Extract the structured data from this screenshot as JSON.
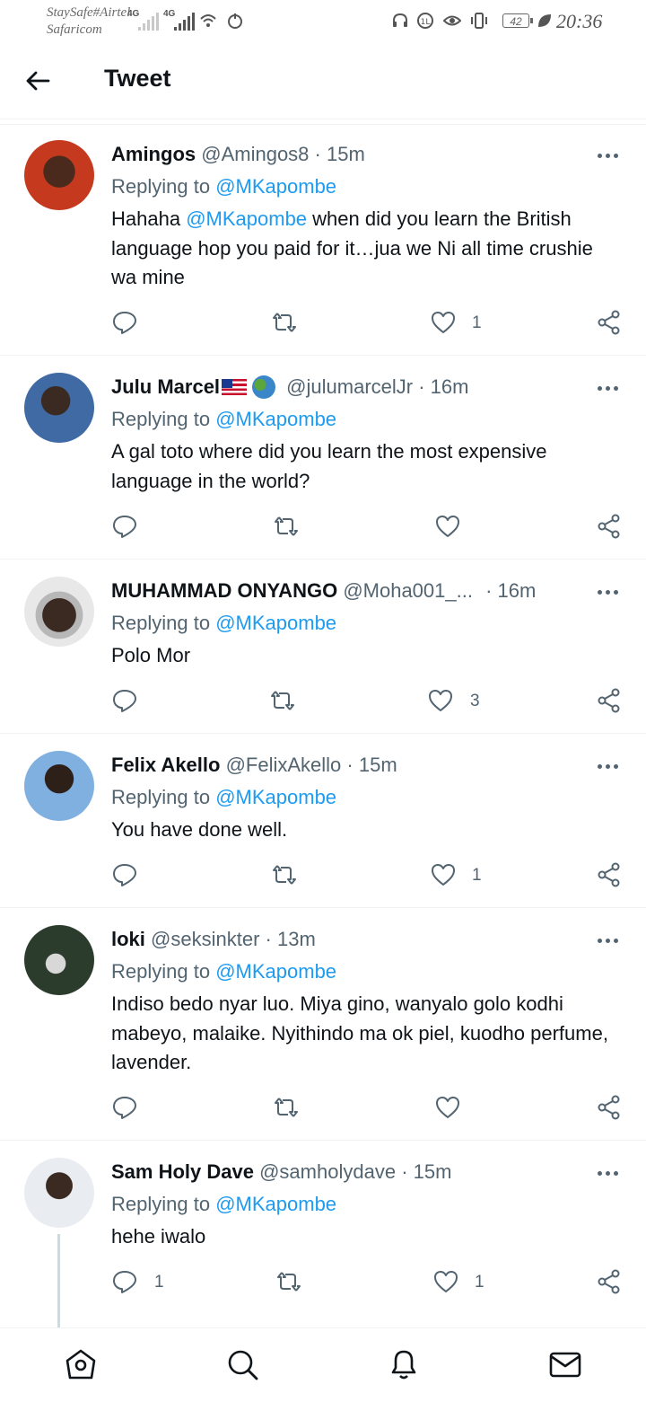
{
  "status_bar": {
    "carrier_line1": "StaySafe#Airtel",
    "carrier_line2": "Safaricom",
    "net1": "4G",
    "net2": "4G",
    "battery": "42",
    "time": "20:36"
  },
  "header": {
    "title": "Tweet"
  },
  "colors": {
    "link": "#1d9bf0",
    "secondary": "#536471",
    "text": "#0f1419"
  },
  "tweets": [
    {
      "name": "Amingos",
      "handle": "@Amingos8",
      "time": "15m",
      "replying_prefix": "Replying to",
      "replying_to": "@MKapombe",
      "text_mention": "@MKapombe",
      "text_pre": "Hahaha",
      "text": "when did you learn the British language hop you paid for it…jua we Ni all time crushie wa mine",
      "like_count": "1"
    },
    {
      "name": "Julu Marcel",
      "handle": "@julumarcelJr",
      "time": "16m",
      "replying_prefix": "Replying to",
      "replying_to": "@MKapombe",
      "text": "A gal toto where did you learn the most expensive language in the world?"
    },
    {
      "name": "MUHAMMAD ONYANGO",
      "handle": "@Moha001_...",
      "time": "16m",
      "replying_prefix": "Replying to",
      "replying_to": "@MKapombe",
      "text": "Polo Mor",
      "like_count": "3"
    },
    {
      "name": "Felix Akello",
      "handle": "@FelixAkello",
      "time": "15m",
      "replying_prefix": "Replying to",
      "replying_to": "@MKapombe",
      "text": "You have done well.",
      "like_count": "1"
    },
    {
      "name": "loki",
      "handle": "@seksinkter",
      "time": "13m",
      "replying_prefix": "Replying to",
      "replying_to": "@MKapombe",
      "text": "Indiso bedo nyar luo. Miya gino, wanyalo golo kodhi mabeyo, malaike. Nyithindo ma ok piel, kuodho perfume, lavender."
    },
    {
      "name": "Sam Holy Dave",
      "handle": "@samholydave",
      "time": "15m",
      "replying_prefix": "Replying to",
      "replying_to": "@MKapombe",
      "text": "hehe iwalo",
      "reply_count": "1",
      "like_count": "1"
    }
  ],
  "bottom_nav": [
    "home-icon",
    "search-icon",
    "notifications-icon",
    "messages-icon"
  ]
}
